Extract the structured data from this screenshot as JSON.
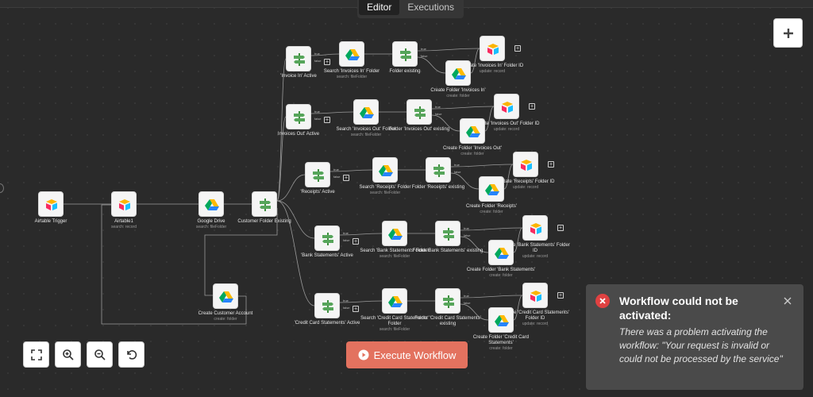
{
  "tabs": [
    {
      "label": "Editor",
      "active": true
    },
    {
      "label": "Executions",
      "active": false
    }
  ],
  "nodes": [
    {
      "id": "trigger",
      "label": "Airtable Trigger",
      "sub": "",
      "icon": "airtable-icon"
    },
    {
      "id": "airtable1",
      "label": "Airtable1",
      "sub": "search: record",
      "icon": "airtable-icon"
    },
    {
      "id": "gdrive",
      "label": "Google Drive",
      "sub": "search: fileFolder",
      "icon": "google-drive-icon"
    },
    {
      "id": "custfolder",
      "label": "Customer Folder Existing",
      "sub": "",
      "icon": "switch-icon"
    },
    {
      "id": "createcust",
      "label": "Create Customer Account",
      "sub": "create: folder",
      "icon": "google-drive-icon"
    },
    {
      "id": "invin",
      "label": "'Invoice In' Active",
      "sub": "",
      "icon": "switch-icon"
    },
    {
      "id": "searchinvin",
      "label": "Search 'Invoices In' Folder",
      "sub": "search: fileFolder",
      "icon": "google-drive-icon"
    },
    {
      "id": "folderexist",
      "label": "Folder existing",
      "sub": "",
      "icon": "switch-icon"
    },
    {
      "id": "updinvin",
      "label": "Update 'Invoices In' Folder ID",
      "sub": "update: record",
      "icon": "airtable-icon"
    },
    {
      "id": "createinvin",
      "label": "Create Folder 'Invoices In'",
      "sub": "create: folder",
      "icon": "google-drive-icon"
    },
    {
      "id": "invout",
      "label": "Invoices Out' Active",
      "sub": "",
      "icon": "switch-icon"
    },
    {
      "id": "searchinvout",
      "label": "Search 'Invoices Out' Folder",
      "sub": "search: fileFolder",
      "icon": "google-drive-icon"
    },
    {
      "id": "folderinvout",
      "label": "Folder 'Invoices Out' existing",
      "sub": "",
      "icon": "switch-icon"
    },
    {
      "id": "updinvout",
      "label": "Update 'Invoices Out' Folder ID",
      "sub": "update: record",
      "icon": "airtable-icon"
    },
    {
      "id": "createinvout",
      "label": "Create Folder 'Invoices Out'",
      "sub": "create: folder",
      "icon": "google-drive-icon"
    },
    {
      "id": "receipts",
      "label": "'Receipts' Active",
      "sub": "",
      "icon": "switch-icon"
    },
    {
      "id": "searchrec",
      "label": "Search 'Receipts' Folder",
      "sub": "search: fileFolder",
      "icon": "google-drive-icon"
    },
    {
      "id": "folderrec",
      "label": "Folder 'Receipts' existing",
      "sub": "",
      "icon": "switch-icon"
    },
    {
      "id": "updrec",
      "label": "Update 'Receipts' Folder ID",
      "sub": "update: record",
      "icon": "airtable-icon"
    },
    {
      "id": "createrec",
      "label": "Create Folder 'Receipts'",
      "sub": "create: folder",
      "icon": "google-drive-icon"
    },
    {
      "id": "bank",
      "label": "'Bank Statements' Active",
      "sub": "",
      "icon": "switch-icon"
    },
    {
      "id": "searchbank",
      "label": "Search 'Bank Statements' Folder",
      "sub": "search: fileFolder",
      "icon": "google-drive-icon"
    },
    {
      "id": "folderbank",
      "label": "Folder 'Bank Statements' existing",
      "sub": "",
      "icon": "switch-icon"
    },
    {
      "id": "updbank",
      "label": "Update 'Bank Statements' Folder ID",
      "sub": "update: record",
      "icon": "airtable-icon"
    },
    {
      "id": "createbank",
      "label": "Create Folder 'Bank Statements'",
      "sub": "create: folder",
      "icon": "google-drive-icon"
    },
    {
      "id": "cc",
      "label": "'Credit Card Statements' Active",
      "sub": "",
      "icon": "switch-icon"
    },
    {
      "id": "searchcc",
      "label": "Search 'Credit Card Statements' Folder",
      "sub": "search: fileFolder",
      "icon": "google-drive-icon"
    },
    {
      "id": "foldercc",
      "label": "Folder 'Credit Card Statements' existing",
      "sub": "",
      "icon": "switch-icon"
    },
    {
      "id": "updcc",
      "label": "Update 'Credit Card Statements' Folder ID",
      "sub": "update: record",
      "icon": "airtable-icon"
    },
    {
      "id": "createcc",
      "label": "Create Folder 'Credit Card Statements'",
      "sub": "create: folder",
      "icon": "google-drive-icon"
    }
  ],
  "branch_labels": {
    "true": "true",
    "false": "false"
  },
  "controls": [
    "zoom-to-fit-icon",
    "zoom-in-icon",
    "zoom-out-icon",
    "reset-zoom-icon"
  ],
  "add_node_icon": "plus-icon",
  "execute_button": {
    "label": "Execute Workflow",
    "icon": "play-icon"
  },
  "toast": {
    "title": "Workflow could not be activated:",
    "message": "There was a problem activating the workflow: \"Your request is invalid or could not be processed by the service\"",
    "icon": "error-icon",
    "close_icon": "close-icon"
  },
  "colors": {
    "background": "#2a2a2a",
    "execute": "#e3725f",
    "toast_bg": "#4a4a4a",
    "error": "#e04141"
  }
}
